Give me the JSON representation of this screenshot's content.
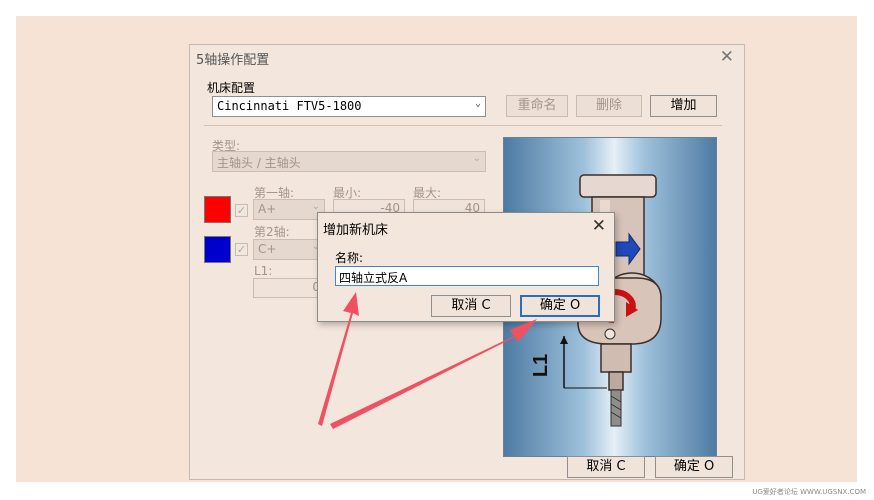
{
  "window": {
    "title": "5轴操作配置",
    "close_glyph": "✕"
  },
  "machine_config": {
    "label": "机床配置",
    "selected_machine": "Cincinnati FTV5-1800",
    "rename_label": "重命名",
    "delete_label": "删除",
    "add_label": "增加"
  },
  "type_section": {
    "label": "类型:",
    "selected": "主轴头 / 主轴头"
  },
  "axis1": {
    "label": "第一轴:",
    "value": "A+",
    "min_label": "最小:",
    "max_label": "最大:",
    "min_value": "-40",
    "max_value": "40",
    "color": "#ff0000"
  },
  "axis2": {
    "label": "第2轴:",
    "value": "C+",
    "color": "#0000cc"
  },
  "l1": {
    "label": "L1:",
    "value": "0"
  },
  "preview": {
    "l1_label": "L1"
  },
  "footer": {
    "cancel_label": "取消 C",
    "ok_label": "确定 O"
  },
  "dialog": {
    "title": "增加新机床",
    "close_glyph": "✕",
    "name_label": "名称:",
    "name_value": "四轴立式反A",
    "cancel_label": "取消 C",
    "ok_label": "确定 O"
  },
  "watermark": "UG爱好者论坛 WWW.UGSNX.COM"
}
